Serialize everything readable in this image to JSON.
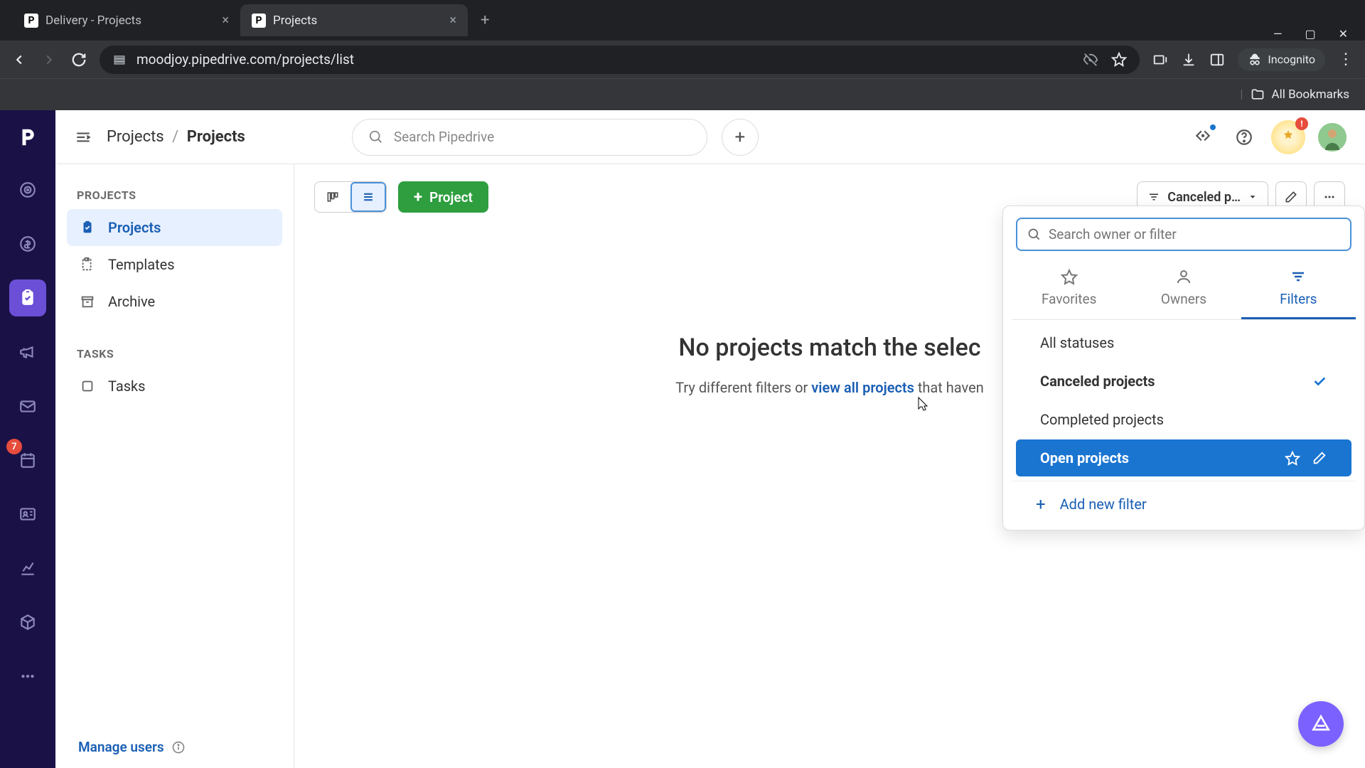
{
  "browser": {
    "tabs": [
      {
        "title": "Delivery - Projects",
        "favicon": "P"
      },
      {
        "title": "Projects",
        "favicon": "P"
      }
    ],
    "url": "moodjoy.pipedrive.com/projects/list",
    "incognito_label": "Incognito",
    "all_bookmarks_label": "All Bookmarks"
  },
  "rail": {
    "badge_count": "7"
  },
  "header": {
    "breadcrumb_root": "Projects",
    "breadcrumb_current": "Projects",
    "search_placeholder": "Search Pipedrive",
    "notification_count": "!"
  },
  "sidebar": {
    "sections": {
      "projects_label": "PROJECTS",
      "tasks_label": "TASKS"
    },
    "items": {
      "projects": "Projects",
      "templates": "Templates",
      "archive": "Archive",
      "tasks": "Tasks"
    },
    "manage_users": "Manage users"
  },
  "toolbar": {
    "new_project_label": "Project",
    "filter_button_label": "Canceled p…"
  },
  "empty": {
    "title": "No projects match the selec",
    "sub_prefix": "Try different filters or ",
    "sub_link": "view all projects",
    "sub_suffix": " that haven"
  },
  "popover": {
    "search_placeholder": "Search owner or filter",
    "tabs": {
      "favorites": "Favorites",
      "owners": "Owners",
      "filters": "Filters"
    },
    "options": {
      "all": "All statuses",
      "canceled": "Canceled projects",
      "completed": "Completed projects",
      "open": "Open projects"
    },
    "add_new": "Add new filter"
  }
}
